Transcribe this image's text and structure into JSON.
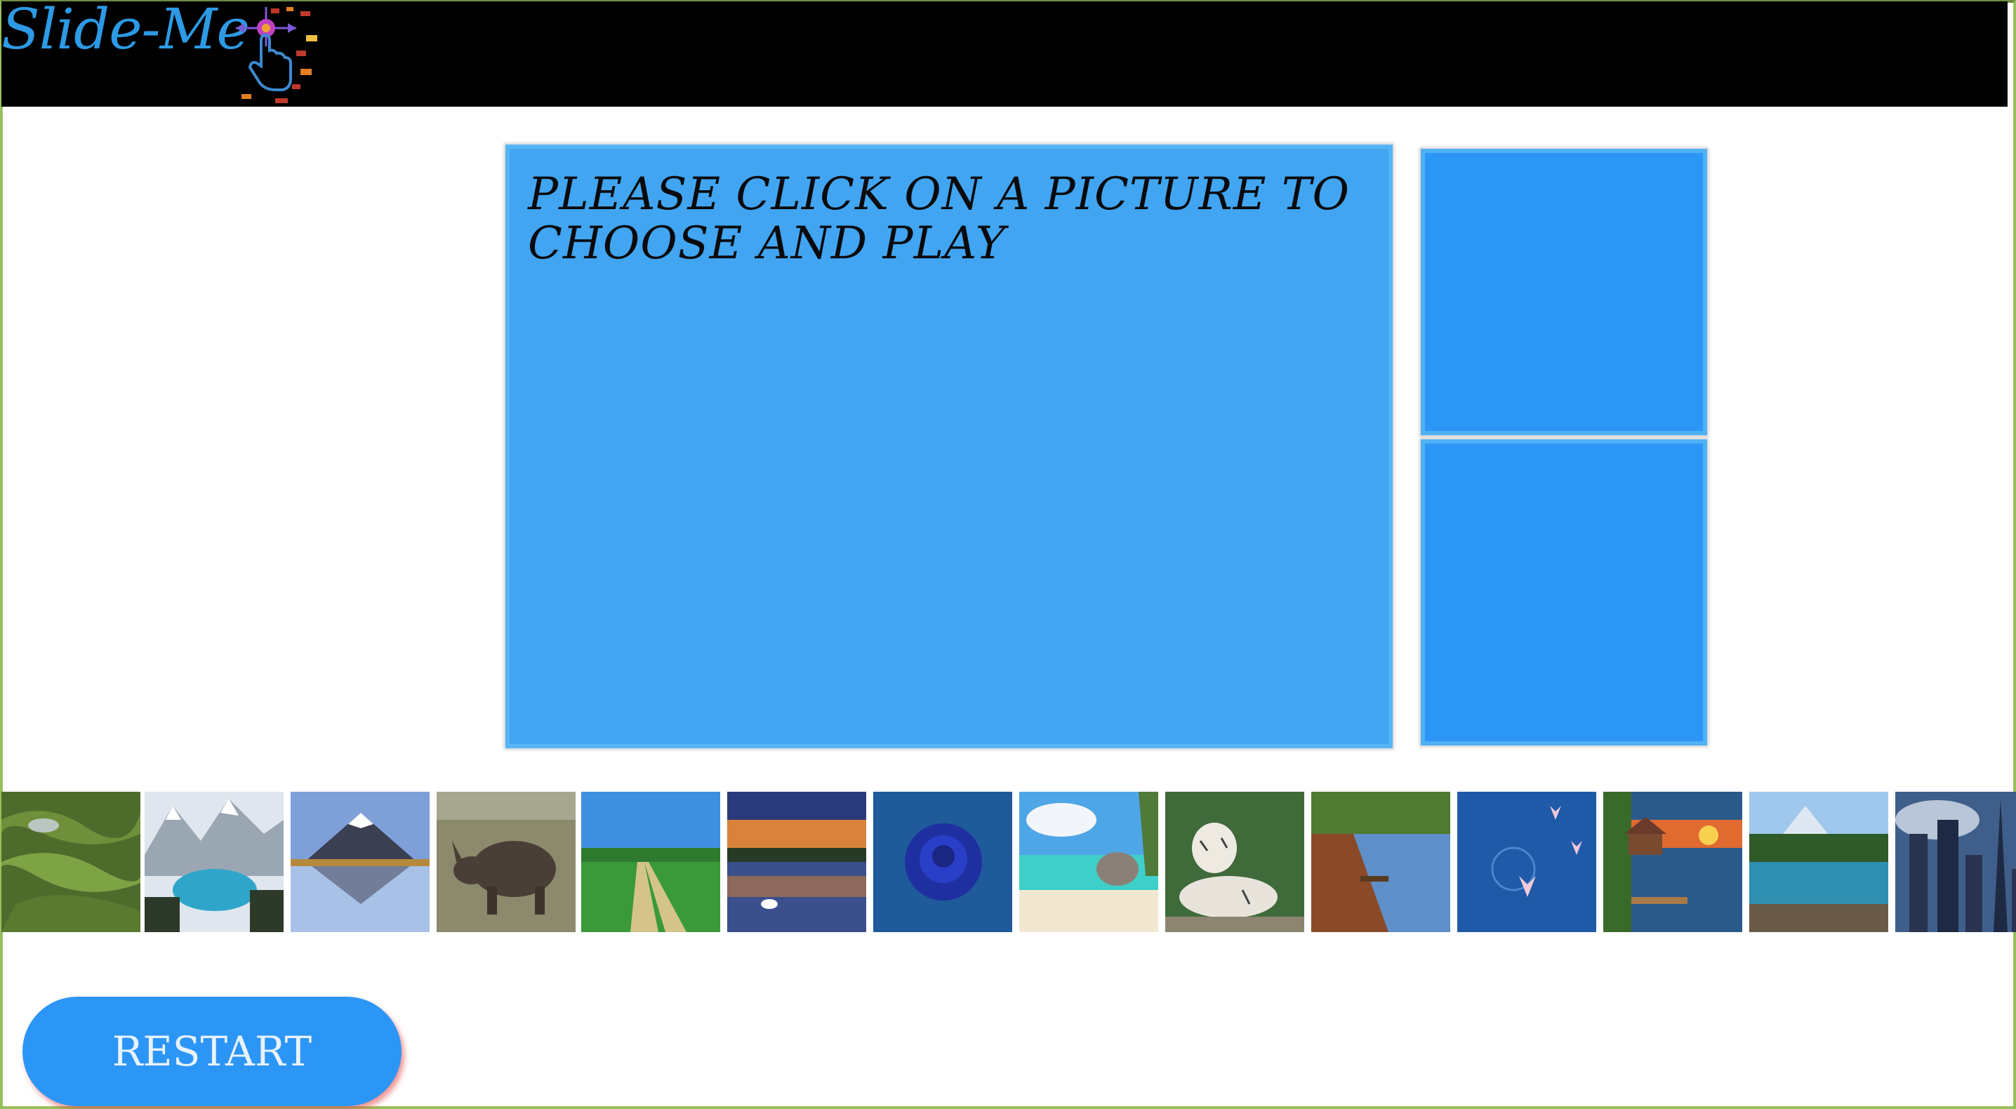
{
  "app": {
    "title": "Slide-Me",
    "logo_icon": "tap-hand-icon"
  },
  "colors": {
    "accent": "#2c96f6",
    "board": "#41a5f2",
    "header": "#000000",
    "frame": "#97c05c"
  },
  "board": {
    "prompt": "PLEASE CLICK ON A PICTURE TO CHOOSE AND PLAY"
  },
  "thumbnails": [
    {
      "subject": "rice terraces"
    },
    {
      "subject": "mountain lake"
    },
    {
      "subject": "snow volcano reflection"
    },
    {
      "subject": "rhinoceros"
    },
    {
      "subject": "grass field path"
    },
    {
      "subject": "swan at sunset"
    },
    {
      "subject": "blue rose"
    },
    {
      "subject": "tropical beach"
    },
    {
      "subject": "white tiger"
    },
    {
      "subject": "lakeside autumn"
    },
    {
      "subject": "water lilies"
    },
    {
      "subject": "cabin at sunset"
    },
    {
      "subject": "alpine lake"
    },
    {
      "subject": "city skyline"
    }
  ],
  "controls": {
    "restart_label": "RESTART"
  }
}
